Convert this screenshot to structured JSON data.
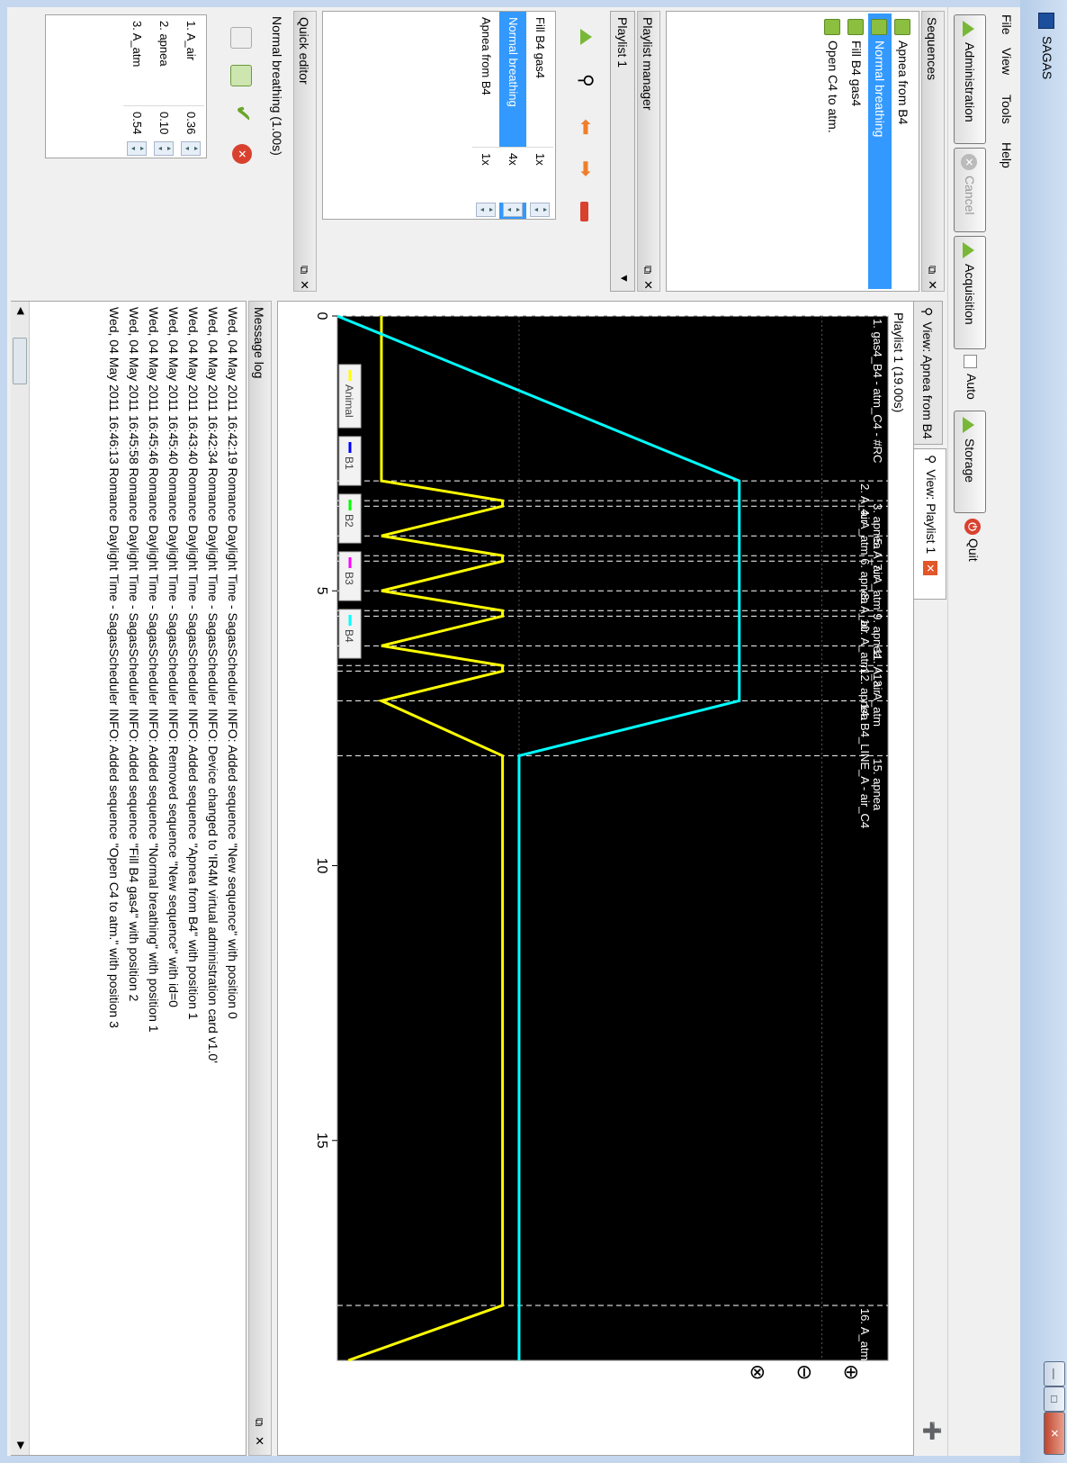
{
  "window": {
    "title": "SAGAS"
  },
  "menu": [
    "File",
    "View",
    "Tools",
    "Help"
  ],
  "toolbar": {
    "administration": "Administration",
    "cancel": "Cancel",
    "acquisition": "Acquisition",
    "auto": "Auto",
    "storage": "Storage",
    "quit": "Quit"
  },
  "sequences": {
    "title": "Sequences",
    "items": [
      {
        "label": "Apnea from B4",
        "selected": false
      },
      {
        "label": "Normal breathing",
        "selected": true
      },
      {
        "label": "Fill B4 gas4",
        "selected": false
      },
      {
        "label": "Open C4 to atm.",
        "selected": false
      }
    ]
  },
  "playlist_manager": {
    "title": "Playlist manager",
    "selected_playlist": "Playlist 1",
    "rows": [
      {
        "name": "Fill B4 gas4",
        "count": "1x",
        "selected": false
      },
      {
        "name": "Normal breathing",
        "count": "4x",
        "selected": true
      },
      {
        "name": "Apnea from B4",
        "count": "1x",
        "selected": false
      }
    ]
  },
  "quick_editor": {
    "title": "Quick editor",
    "caption": "Normal breathing  (1.00s)",
    "rows": [
      {
        "name": "1. A_air",
        "value": "0.36"
      },
      {
        "name": "2. apnea",
        "value": "0.10"
      },
      {
        "name": "3. A_atm",
        "value": "0.54"
      }
    ]
  },
  "tabs": [
    {
      "label": "View: Apnea from B4",
      "active": false
    },
    {
      "label": "View: Playlist 1",
      "active": true
    }
  ],
  "view": {
    "caption": "Playlist 1  (19.00s)"
  },
  "chart_data": {
    "type": "line",
    "title": "",
    "xlim": [
      0,
      19
    ],
    "xticks": [
      "0",
      "5",
      "10",
      "15"
    ],
    "background": "#000000",
    "legend": {
      "placement": "top-left",
      "entries": [
        {
          "name": "Animal",
          "color": "#ffff00"
        },
        {
          "name": "B1",
          "color": "#0000ff"
        },
        {
          "name": "B2",
          "color": "#00ff00"
        },
        {
          "name": "B3",
          "color": "#ff00ff"
        },
        {
          "name": "B4",
          "color": "#00ffff"
        }
      ]
    },
    "series": [
      {
        "name": "Animal",
        "color": "#ffff00",
        "x": [
          0,
          3,
          3.36,
          3.46,
          4,
          4.36,
          4.46,
          5,
          5.36,
          5.46,
          6,
          6.36,
          6.46,
          7,
          8,
          18,
          19
        ],
        "y": [
          0.08,
          0.08,
          0.3,
          0.3,
          0.08,
          0.3,
          0.3,
          0.08,
          0.3,
          0.3,
          0.08,
          0.3,
          0.3,
          0.08,
          0.3,
          0.3,
          0.02
        ]
      },
      {
        "name": "B4",
        "color": "#00ffff",
        "x": [
          0,
          3,
          7,
          8,
          19
        ],
        "y": [
          0.0,
          0.73,
          0.73,
          0.33,
          0.33
        ]
      }
    ],
    "markers": [
      {
        "x": 0,
        "label": "1. gas4_B4 - atm_C4 - #RC"
      },
      {
        "x": 3,
        "label": "2. A_air"
      },
      {
        "x": 3.36,
        "label": "3. apnea"
      },
      {
        "x": 3.46,
        "label": "4. A_atm"
      },
      {
        "x": 4,
        "label": "5. A_air"
      },
      {
        "x": 4.36,
        "label": "6. apnea"
      },
      {
        "x": 4.46,
        "label": "7. A_atm"
      },
      {
        "x": 5,
        "label": "8. A_air"
      },
      {
        "x": 5.36,
        "label": "9. apnea"
      },
      {
        "x": 5.46,
        "label": "10. A_atm"
      },
      {
        "x": 6,
        "label": "11. A_air"
      },
      {
        "x": 6.36,
        "label": "12. apnea"
      },
      {
        "x": 6.46,
        "label": "13. A_atm"
      },
      {
        "x": 7,
        "label": "14. B4_LINE_A - air_C4"
      },
      {
        "x": 8,
        "label": "15. apnea"
      },
      {
        "x": 18,
        "label": "16. A_atm"
      }
    ]
  },
  "message_log": {
    "title": "Message log",
    "lines": [
      "Wed, 04 May 2011 16:42:19 Romance Daylight Time - SagasScheduler INFO: Added sequence \"New sequence\" with position 0",
      "Wed, 04 May 2011 16:42:34 Romance Daylight Time - SagasScheduler INFO: Device changed to 'IR4M virtual administration card v1.0'",
      "Wed, 04 May 2011 16:43:40 Romance Daylight Time - SagasScheduler INFO: Added sequence \"Apnea from B4\" with position 1",
      "Wed, 04 May 2011 16:45:40 Romance Daylight Time - SagasScheduler INFO: Removed sequence \"New sequence\" with id=0",
      "Wed, 04 May 2011 16:45:46 Romance Daylight Time - SagasScheduler INFO: Added sequence \"Normal breathing\" with position 1",
      "Wed, 04 May 2011 16:45:58 Romance Daylight Time - SagasScheduler INFO: Added sequence \"Fill B4 gas4\" with position 2",
      "Wed, 04 May 2011 16:46:13 Romance Daylight Time - SagasScheduler INFO: Added sequence \"Open C4 to atm.\" with position 3"
    ]
  },
  "icons": [
    "app-icon",
    "minimize-icon",
    "maximize-icon",
    "close-icon",
    "play-icon",
    "cancel-icon",
    "power-icon",
    "magnifier-icon",
    "arrow-left-icon",
    "arrow-right-icon",
    "remove-icon",
    "check-icon",
    "delete-icon",
    "zoom-in-icon",
    "zoom-out-icon",
    "zoom-fit-icon"
  ]
}
